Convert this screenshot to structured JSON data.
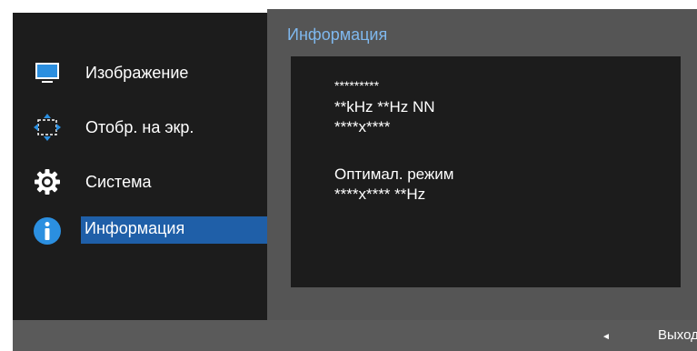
{
  "menu": {
    "items": [
      {
        "label": "Изображение",
        "icon": "monitor-icon"
      },
      {
        "label": "Отобр. на экр.",
        "icon": "screen-arrows-icon"
      },
      {
        "label": "Система",
        "icon": "gear-icon"
      },
      {
        "label": "Информация",
        "icon": "info-icon",
        "selected": true
      }
    ]
  },
  "panel": {
    "title": "Информация",
    "lines": [
      "*********",
      "**kHz **Hz NN",
      "****x****",
      "Оптимал. режим",
      "****x**** **Hz"
    ]
  },
  "footer": {
    "arrow": "◄",
    "exit_label": "Выход"
  },
  "colors": {
    "selected_bg": "#1f5fa8",
    "title_color": "#7fb8ee",
    "menu_bg": "#1c1c1c",
    "panel_bg": "#555555"
  }
}
